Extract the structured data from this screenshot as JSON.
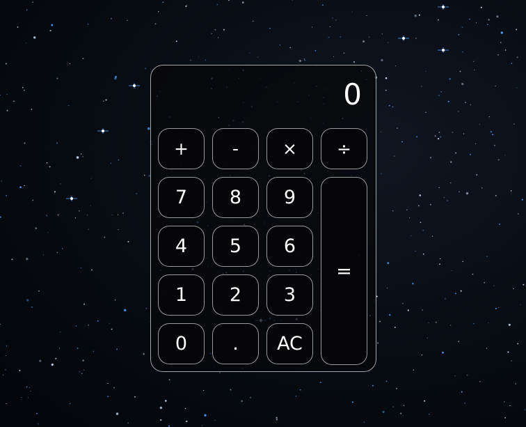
{
  "calculator": {
    "display": "0",
    "keys": {
      "add": "+",
      "subtract": "-",
      "multiply": "×",
      "divide": "÷",
      "seven": "7",
      "eight": "8",
      "nine": "9",
      "four": "4",
      "five": "5",
      "six": "6",
      "one": "1",
      "two": "2",
      "three": "3",
      "zero": "0",
      "decimal": ".",
      "clear": "AC",
      "equals": "="
    }
  },
  "background": {
    "image": "night-sky-starfield",
    "base_color": "#070b12",
    "star_color": "#cfe3ff",
    "accent_star_color": "#4da3ff"
  }
}
